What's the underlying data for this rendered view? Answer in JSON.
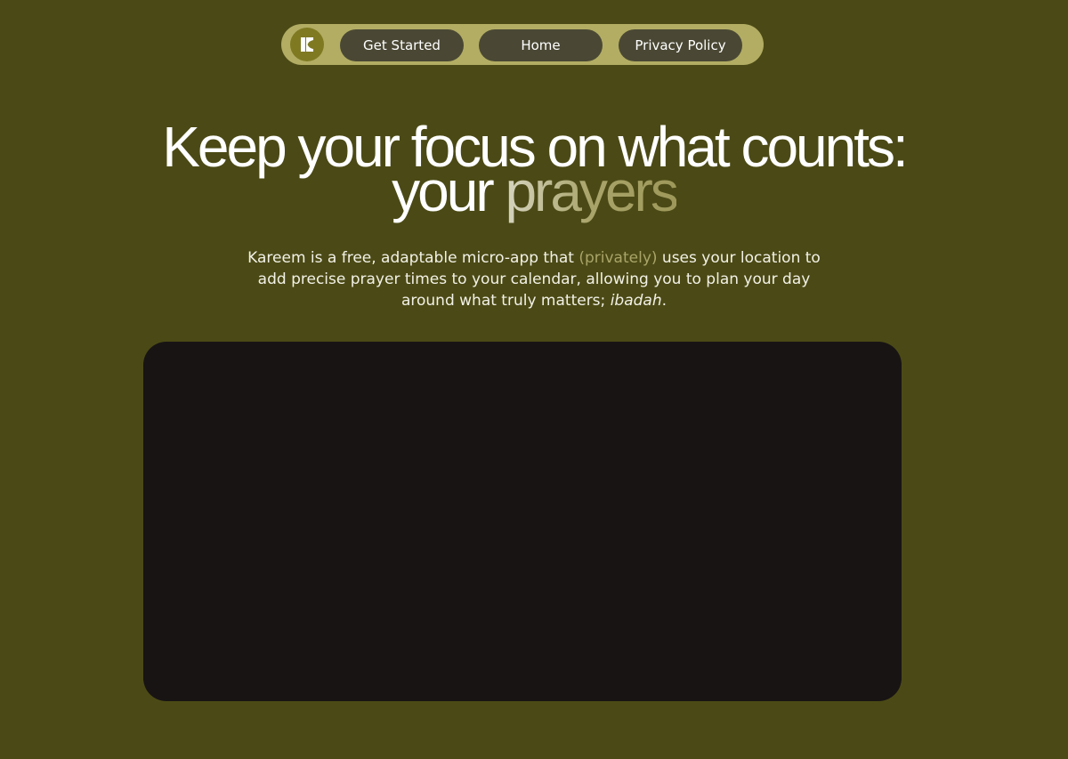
{
  "nav": {
    "logo_letter": "K",
    "buttons": [
      {
        "label": "Get Started"
      },
      {
        "label": "Home"
      },
      {
        "label": "Privacy Policy"
      }
    ]
  },
  "hero": {
    "headline_line1": "Keep your focus on what counts:",
    "headline_line2_plain": "your ",
    "headline_line2_accent": "prayers",
    "subtitle_part1": "Kareem is a free, adaptable micro-app that ",
    "subtitle_muted": "(privately)",
    "subtitle_part2": " uses your location to add precise prayer times to your calendar, allowing you to plan your day around what truly matters; ",
    "subtitle_em": "ibadah",
    "subtitle_end": "."
  },
  "colors": {
    "background": "#4b4a16",
    "nav_pill": "#b2ad63",
    "nav_button": "#4a4834",
    "logo_circle": "#7f7a22",
    "accent_text": "#a9a468",
    "panel": "#181414"
  },
  "icons": {
    "logo": "kareem-logo-icon"
  }
}
